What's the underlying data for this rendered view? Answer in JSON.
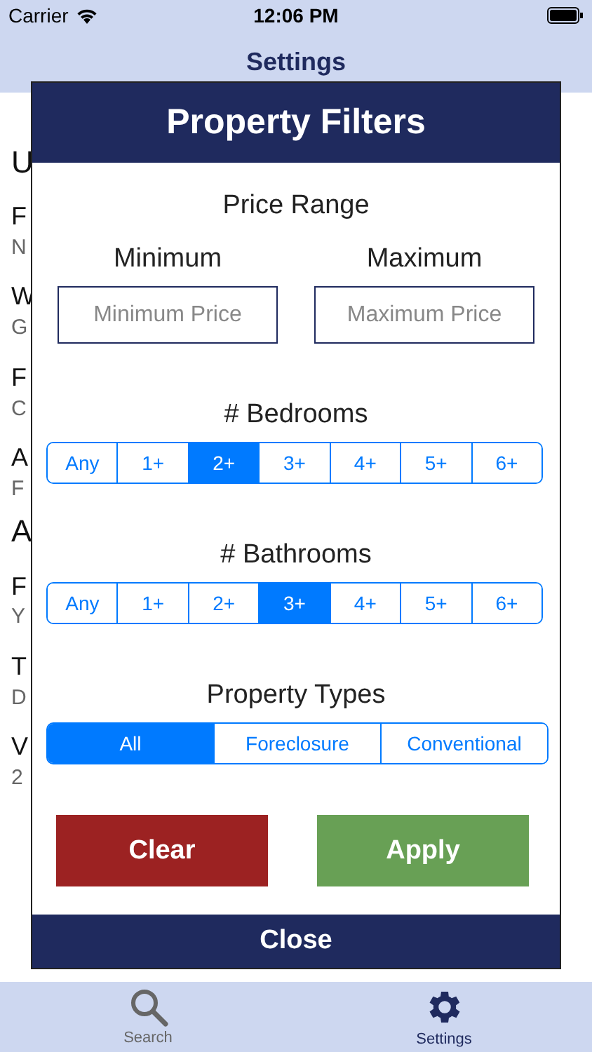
{
  "status_bar": {
    "carrier": "Carrier",
    "time": "12:06 PM"
  },
  "nav_bar": {
    "title": "Settings"
  },
  "background_entries": [
    {
      "kind": "heading",
      "text": "U"
    },
    {
      "kind": "label",
      "text": "F"
    },
    {
      "kind": "value",
      "text": "N"
    },
    {
      "kind": "label",
      "text": "W"
    },
    {
      "kind": "value",
      "text": "G"
    },
    {
      "kind": "label",
      "text": "F"
    },
    {
      "kind": "value",
      "text": "C"
    },
    {
      "kind": "label",
      "text": "A"
    },
    {
      "kind": "value",
      "text": "F"
    },
    {
      "kind": "heading",
      "text": "A"
    },
    {
      "kind": "label",
      "text": "F"
    },
    {
      "kind": "value",
      "text": "Y"
    },
    {
      "kind": "label",
      "text": "T"
    },
    {
      "kind": "value",
      "text": "D"
    },
    {
      "kind": "label",
      "text": "V"
    },
    {
      "kind": "value",
      "text": "2"
    }
  ],
  "modal": {
    "title": "Property Filters",
    "price_range": {
      "title": "Price Range",
      "minimum": {
        "label": "Minimum",
        "placeholder": "Minimum Price"
      },
      "maximum": {
        "label": "Maximum",
        "placeholder": "Maximum Price"
      }
    },
    "bedrooms": {
      "title": "# Bedrooms",
      "options": [
        {
          "label": "Any",
          "selected": false
        },
        {
          "label": "1+",
          "selected": false
        },
        {
          "label": "2+",
          "selected": true
        },
        {
          "label": "3+",
          "selected": false
        },
        {
          "label": "4+",
          "selected": false
        },
        {
          "label": "5+",
          "selected": false
        },
        {
          "label": "6+",
          "selected": false
        }
      ]
    },
    "bathrooms": {
      "title": "# Bathrooms",
      "options": [
        {
          "label": "Any",
          "selected": false
        },
        {
          "label": "1+",
          "selected": false
        },
        {
          "label": "2+",
          "selected": false
        },
        {
          "label": "3+",
          "selected": true
        },
        {
          "label": "4+",
          "selected": false
        },
        {
          "label": "5+",
          "selected": false
        },
        {
          "label": "6+",
          "selected": false
        }
      ]
    },
    "property_types": {
      "title": "Property Types",
      "options": [
        {
          "label": "All",
          "selected": true
        },
        {
          "label": "Foreclosure",
          "selected": false
        },
        {
          "label": "Conventional",
          "selected": false
        }
      ]
    },
    "buttons": [
      {
        "kind": "clear",
        "label": "Clear"
      },
      {
        "kind": "apply",
        "label": "Apply"
      }
    ],
    "close": "Close"
  },
  "tab_bar": [
    {
      "kind": "search",
      "label": "Search",
      "selected": false
    },
    {
      "kind": "settings",
      "label": "Settings",
      "selected": true
    }
  ]
}
